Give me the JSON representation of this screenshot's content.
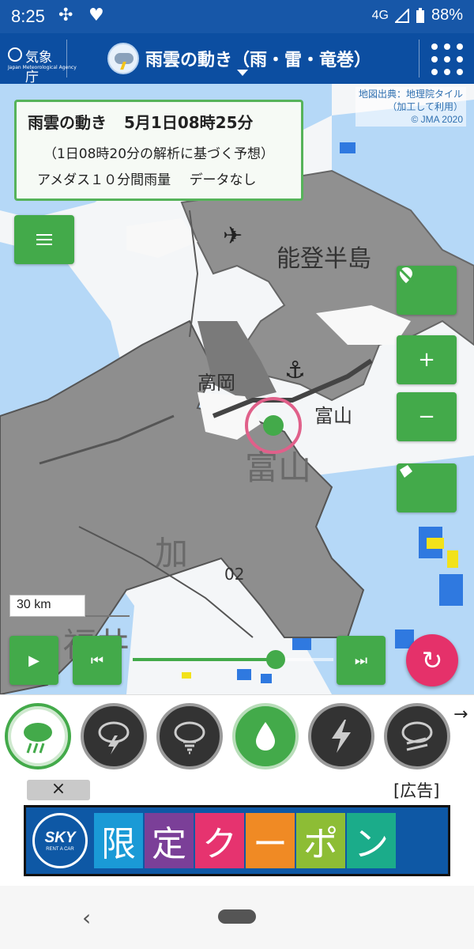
{
  "status_bar": {
    "time": "8:25",
    "network": "4G",
    "battery": "88%"
  },
  "app_bar": {
    "agency_name": "気象庁",
    "agency_name_en": "Japan Meteorological Agency",
    "title": "雨雲の動き（雨・雷・竜巻）"
  },
  "map": {
    "attribution": [
      "地図出典：地理院タイル",
      "（加工して利用）",
      "© JMA 2020"
    ],
    "info": {
      "title": "雨雲の動き",
      "datetime": "5月1日08時25分",
      "forecast_note": "（1日08時20分の解析に基づく予想）",
      "amedas_label": "アメダス１０分間雨量",
      "amedas_status": "データなし"
    },
    "labels": {
      "noto": "能登半島",
      "takaoka": "高岡",
      "toyama_city": "富山",
      "toyama_pref": "富山",
      "fukui_partial": "福井",
      "kanazawa_partial": "加",
      "route": "02"
    },
    "scale": "30 km"
  },
  "mode_buttons": [
    {
      "icon": "rain-cloud-icon",
      "selected": true
    },
    {
      "icon": "thunder-cloud-icon",
      "selected": false
    },
    {
      "icon": "tornado-cloud-icon",
      "selected": false
    },
    {
      "icon": "water-drop-icon",
      "selected": false
    },
    {
      "icon": "lightning-icon",
      "selected": false
    },
    {
      "icon": "heavy-rain-cloud-icon",
      "selected": false
    }
  ],
  "ad": {
    "close_label": "×",
    "label": "[広告]",
    "brand": "SKY",
    "brand_sub": "RENT A CAR",
    "chars": [
      "限",
      "定",
      "ク",
      "ー",
      "ポ",
      "ン"
    ],
    "char_colors": [
      "#1a9ad6",
      "#7b3f98",
      "#e6336f",
      "#f08a24",
      "#8dbd35",
      "#1bac8a"
    ]
  },
  "colors": {
    "accent_green": "#43aa4a",
    "app_blue": "#0c4ea1",
    "refresh_pink": "#e5316a"
  }
}
